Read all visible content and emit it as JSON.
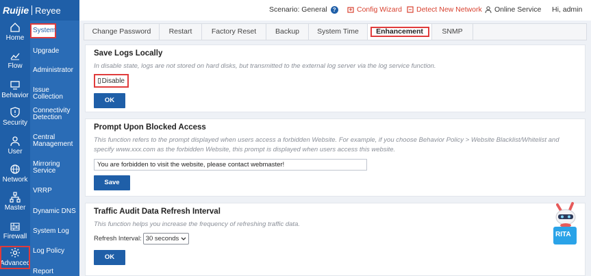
{
  "header": {
    "logo_brand": "Ruijie",
    "logo_sub": "Reyee",
    "scenario_label": "Scenario:",
    "scenario_value": "General",
    "config_wizard": "Config Wizard",
    "detect_network": "Detect New Network",
    "online_service": "Online Service",
    "user_greeting": "Hi, admin"
  },
  "nav_primary": {
    "items": [
      {
        "label": "Home",
        "icon": "home-icon"
      },
      {
        "label": "Flow",
        "icon": "flow-icon"
      },
      {
        "label": "Behavior",
        "icon": "behavior-icon"
      },
      {
        "label": "Security",
        "icon": "shield-icon"
      },
      {
        "label": "User",
        "icon": "user-icon"
      },
      {
        "label": "Network",
        "icon": "globe-icon"
      },
      {
        "label": "Master",
        "icon": "hierarchy-icon"
      },
      {
        "label": "Firewall",
        "icon": "firewall-icon"
      },
      {
        "label": "Advanced",
        "icon": "gear-icon"
      }
    ],
    "active": "Advanced"
  },
  "nav_secondary": {
    "items": [
      "System",
      "Upgrade",
      "Administrator",
      "Issue Collection",
      "Connectivity Detection",
      "Central Management",
      "Mirroring Service",
      "VRRP",
      "Dynamic DNS",
      "System Log",
      "Log Policy",
      "Report"
    ],
    "active": "System"
  },
  "tabs": {
    "items": [
      "Change Password",
      "Restart",
      "Factory Reset",
      "Backup",
      "System Time",
      "Enhancement",
      "SNMP"
    ],
    "active": "Enhancement"
  },
  "save_logs": {
    "title": "Save Logs Locally",
    "description": "In disable state, logs are not stored on hard disks, but transmitted to the external log server via the log service function.",
    "checkbox_label": "Disable",
    "checked": false,
    "ok_label": "OK"
  },
  "blocked_access": {
    "title": "Prompt Upon Blocked Access",
    "description": "This function refers to the prompt displayed when users access a forbidden Website. For example, if you choose Behavior Policy > Website Blacklist/Whitelist and specify www.xxx.com as the forbidden Website, this prompt is displayed when users access this website.",
    "prompt_value": "You are forbidden to visit the website, please contact webmaster!",
    "save_label": "Save"
  },
  "traffic_audit": {
    "title": "Traffic Audit Data Refresh Interval",
    "description": "This function helps you increase the frequency of refreshing traffic data.",
    "interval_label": "Refresh Interval:",
    "interval_value": "30 seconds",
    "ok_label": "OK"
  },
  "assistant": {
    "name": "RITA"
  },
  "colors": {
    "brand_blue": "#1f5fa8",
    "highlight_red": "#e03b3b",
    "link_red": "#d8412f"
  }
}
